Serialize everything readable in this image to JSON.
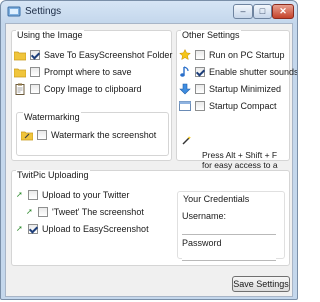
{
  "window": {
    "title": "Settings"
  },
  "using_image": {
    "title": "Using the Image",
    "items": [
      {
        "label": "Save To EasyScreenshot Folder",
        "checked": true,
        "icon": "folder-icon"
      },
      {
        "label": "Prompt where to save",
        "checked": false,
        "icon": "folder-icon"
      },
      {
        "label": "Copy Image to clipboard",
        "checked": false,
        "icon": "clipboard-icon"
      }
    ]
  },
  "watermarking": {
    "title": "Watermarking",
    "item": {
      "label": "Watermark the screenshot",
      "checked": false,
      "icon": "folder-edit-icon"
    }
  },
  "other": {
    "title": "Other Settings",
    "items": [
      {
        "label": "Run on PC Startup",
        "checked": false,
        "icon": "star-icon"
      },
      {
        "label": "Enable shutter sounds",
        "checked": true,
        "icon": "music-note-icon"
      },
      {
        "label": "Startup Minimized",
        "checked": false,
        "icon": "arrow-down-icon"
      },
      {
        "label": "Startup Compact",
        "checked": false,
        "icon": "window-icon"
      }
    ],
    "hint": "Press Alt + Shift + F for easy access to a full window shot"
  },
  "twitpic": {
    "title": "TwitPic Uploading",
    "items": [
      {
        "label": "Upload to your Twitter",
        "checked": false
      },
      {
        "label": "'Tweet' The screenshot",
        "checked": false
      },
      {
        "label": "Upload to EasyScreenshot",
        "checked": true
      }
    ],
    "credentials": {
      "title": "Your Credentials",
      "username_label": "Username:",
      "username_value": "",
      "password_label": "Password",
      "password_value": ""
    }
  },
  "buttons": {
    "save_label": "Save Settings"
  }
}
